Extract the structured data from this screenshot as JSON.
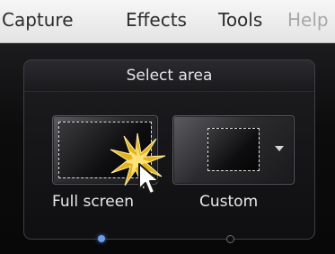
{
  "menubar": {
    "items": [
      {
        "label": "Capture"
      },
      {
        "label": "Effects"
      },
      {
        "label": "Tools"
      },
      {
        "label": "Help"
      }
    ]
  },
  "select_area": {
    "title": "Select area",
    "options": [
      {
        "label": "Full screen",
        "icon": "full-screen-icon",
        "state": "hovered"
      },
      {
        "label": "Custom",
        "icon": "custom-region-icon",
        "has_dropdown": true
      }
    ],
    "page_count": 2,
    "active_page": 1
  },
  "colors": {
    "menu_bg": "#ebebeb",
    "panel_bg": "#0c0c0d",
    "accent_dot": "#6f9ee8",
    "burst": "#e5b21a"
  }
}
